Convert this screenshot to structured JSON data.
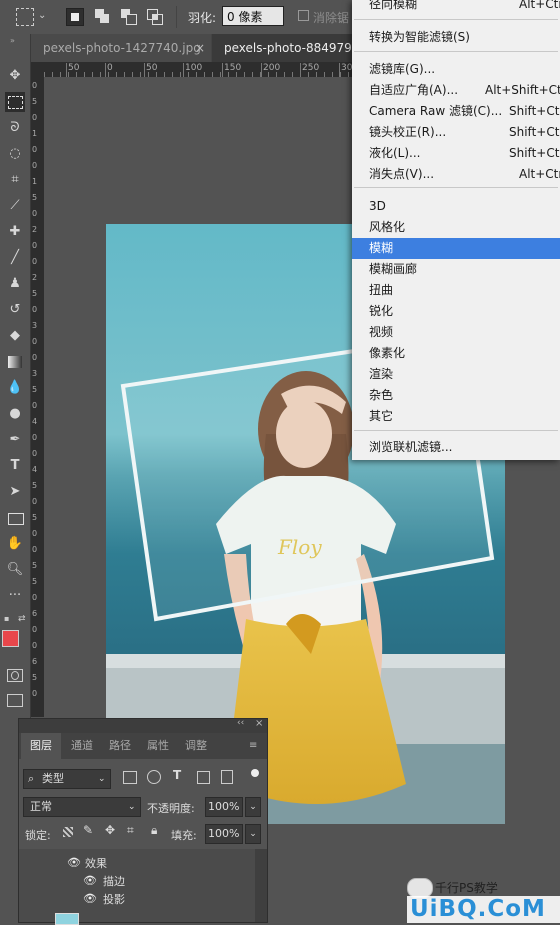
{
  "options_bar": {
    "feather_label": "羽化:",
    "feather_value": "0 像素",
    "antialias_label": "消除锯"
  },
  "tabs": [
    {
      "label": "pexels-photo-1427740.jpg",
      "close": "×"
    },
    {
      "label": "pexels-photo-884979.jpg",
      "close": "×"
    }
  ],
  "ruler_top_labels": [
    "50",
    "0",
    "50",
    "100",
    "150",
    "200",
    "250",
    "300",
    "350",
    "400",
    "450",
    "500",
    "550"
  ],
  "ruler_left_labels": [
    "0",
    "5",
    "0",
    "1",
    "0",
    "0",
    "1",
    "5",
    "0",
    "2",
    "0",
    "0",
    "2",
    "5",
    "0",
    "3",
    "0",
    "0",
    "3",
    "5",
    "0",
    "4",
    "0",
    "0",
    "4",
    "5",
    "0",
    "5",
    "0",
    "0",
    "5",
    "5",
    "0",
    "6",
    "0",
    "0",
    "6",
    "5",
    "0"
  ],
  "menu": {
    "top_items": [
      {
        "label": "径向模糊",
        "shortcut": "Alt+Ctr"
      },
      {
        "label": "转换为智能滤镜(S)",
        "shortcut": ""
      },
      {
        "label": "滤镜库(G)...",
        "shortcut": ""
      },
      {
        "label": "自适应广角(A)...",
        "shortcut": "Alt+Shift+Ctr"
      },
      {
        "label": "Camera Raw 滤镜(C)...",
        "shortcut": "Shift+Ctr"
      },
      {
        "label": "镜头校正(R)...",
        "shortcut": "Shift+Ctr"
      },
      {
        "label": "液化(L)...",
        "shortcut": "Shift+Ctr"
      },
      {
        "label": "消失点(V)...",
        "shortcut": "Alt+Ctr"
      }
    ],
    "filter_groups": [
      "3D",
      "风格化",
      "模糊",
      "模糊画廊",
      "扭曲",
      "锐化",
      "视频",
      "像素化",
      "渲染",
      "杂色",
      "其它"
    ],
    "highlighted": "模糊",
    "browse": "浏览联机滤镜..."
  },
  "layers_panel": {
    "tabs": [
      "图层",
      "通道",
      "路径",
      "属性",
      "调整"
    ],
    "filter_kind": "类型",
    "blend_mode": "正常",
    "opacity_label": "不透明度:",
    "opacity_value": "100%",
    "lock_label": "锁定:",
    "fill_label": "填充:",
    "fill_value": "100%",
    "effects_label": "效果",
    "effects": [
      "描边",
      "投影"
    ]
  },
  "watermark": {
    "text": "千行PS教学",
    "logo": "UiBQ.CoM"
  },
  "colors": {
    "foreground": "#e8474b",
    "background": "#000000",
    "menu_highlight": "#3d7fe0"
  },
  "tool_icons": [
    "move-icon",
    "marquee-icon",
    "lasso-icon",
    "quick-select-icon",
    "crop-icon",
    "eyedropper-icon",
    "healing-icon",
    "brush-icon",
    "stamp-icon",
    "history-brush-icon",
    "eraser-icon",
    "gradient-icon",
    "blur-icon",
    "dodge-icon",
    "pen-icon",
    "type-icon",
    "path-select-icon",
    "rectangle-icon",
    "hand-icon",
    "zoom-icon",
    "more-icon"
  ]
}
